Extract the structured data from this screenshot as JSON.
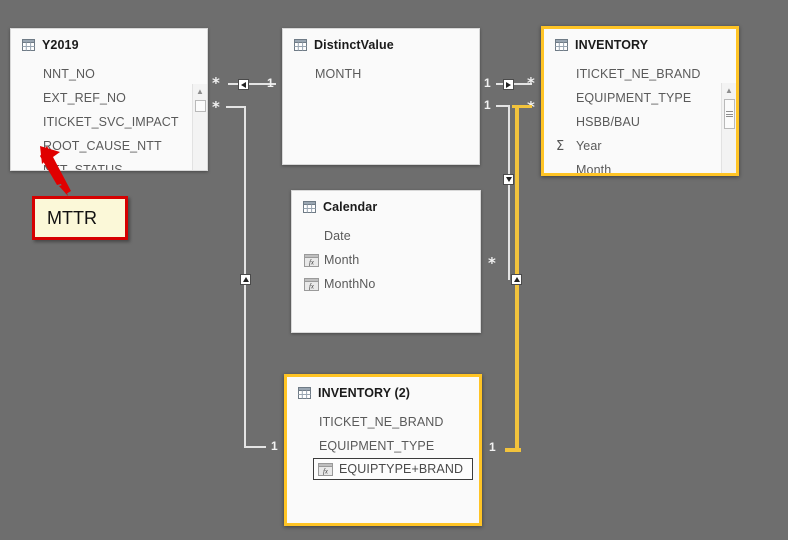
{
  "canvas": {
    "background_color": "#6e6e6e",
    "selection_color": "#ffc425",
    "relationship_line_color": "#e4e4e4",
    "highlight_line_color": "#f5c518"
  },
  "tables": [
    {
      "name": "Y2019",
      "icon": "table-icon",
      "selected": false,
      "has_scrollbar": true,
      "fields": [
        {
          "label": "NNT_NO",
          "glyph": "none"
        },
        {
          "label": "EXT_REF_NO",
          "glyph": "none"
        },
        {
          "label": "ITICKET_SVC_IMPACT",
          "glyph": "none"
        },
        {
          "label": "ROOT_CAUSE_NTT",
          "glyph": "none"
        },
        {
          "label": "NTT_STATUS",
          "glyph": "none"
        }
      ]
    },
    {
      "name": "DistinctValue",
      "icon": "table-icon",
      "selected": false,
      "has_scrollbar": false,
      "fields": [
        {
          "label": "MONTH",
          "glyph": "none"
        }
      ]
    },
    {
      "name": "INVENTORY",
      "icon": "table-icon",
      "selected": true,
      "has_scrollbar": true,
      "fields": [
        {
          "label": "ITICKET_NE_BRAND",
          "glyph": "none"
        },
        {
          "label": "EQUIPMENT_TYPE",
          "glyph": "none"
        },
        {
          "label": "HSBB/BAU",
          "glyph": "none"
        },
        {
          "label": "Year",
          "glyph": "sigma-icon"
        },
        {
          "label": "Month",
          "glyph": "none"
        }
      ]
    },
    {
      "name": "Calendar",
      "icon": "table-icon",
      "selected": false,
      "has_scrollbar": false,
      "fields": [
        {
          "label": "Date",
          "glyph": "none"
        },
        {
          "label": "Month",
          "glyph": "calculated-column-icon"
        },
        {
          "label": "MonthNo",
          "glyph": "calculated-column-icon"
        }
      ]
    },
    {
      "name": "INVENTORY (2)",
      "icon": "table-icon",
      "selected": true,
      "has_scrollbar": false,
      "fields": [
        {
          "label": "ITICKET_NE_BRAND",
          "glyph": "none"
        },
        {
          "label": "EQUIPMENT_TYPE",
          "glyph": "none"
        },
        {
          "label": "EQUIPTYPE+BRAND",
          "glyph": "calculated-column-icon",
          "highlighted": true
        }
      ]
    }
  ],
  "relationships": [
    {
      "id": "y2019-distinctvalue",
      "from_cardinality": "*",
      "to_cardinality": "1",
      "direction": "left",
      "highlighted": false
    },
    {
      "id": "y2019-inventory2",
      "from_cardinality": "*",
      "to_cardinality": "1",
      "direction": "up",
      "highlighted": false
    },
    {
      "id": "distinctvalue-inventory",
      "from_cardinality": "1",
      "to_cardinality": "*",
      "direction": "right",
      "highlighted": false
    },
    {
      "id": "calendar-inventory",
      "from_cardinality": "1",
      "to_cardinality": "*",
      "mid_cardinality": "*",
      "direction": "down",
      "highlighted": false
    },
    {
      "id": "inventory-inventory2",
      "from_cardinality": "*",
      "to_cardinality": "1",
      "direction": "up",
      "highlighted": true
    }
  ],
  "annotation": {
    "label": "MTTR",
    "box_fill": "#fbf8d8",
    "box_border": "#d60000",
    "arrow_color": "#e00000",
    "points_at": "Y2019"
  }
}
